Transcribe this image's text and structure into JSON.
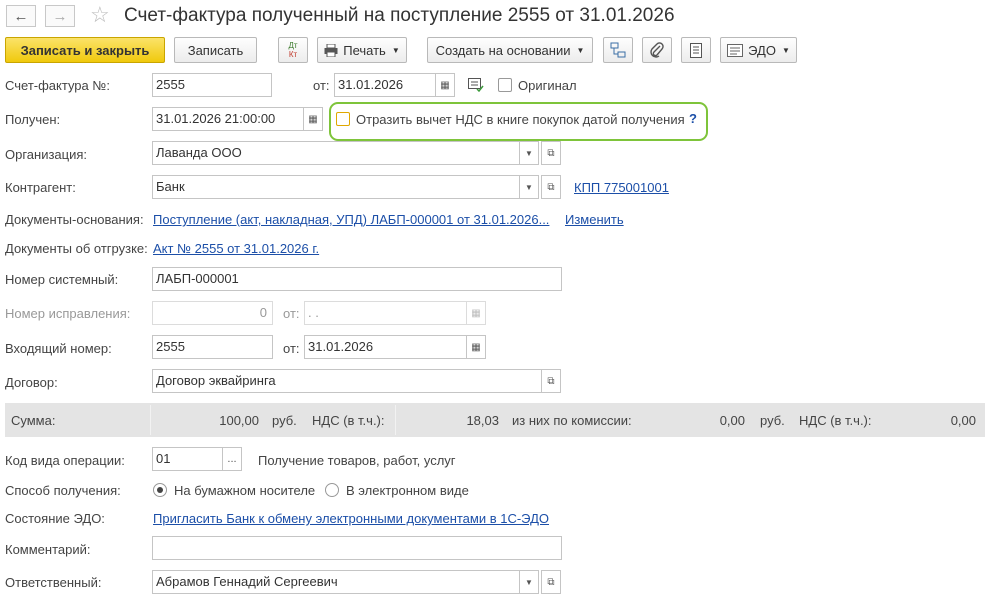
{
  "header": {
    "title": "Счет-фактура полученный на поступление 2555 от 31.01.2026"
  },
  "toolbar": {
    "save_close": "Записать и закрыть",
    "save": "Записать",
    "dtkt_top": "Дт",
    "dtkt_bottom": "Кт",
    "print": "Печать",
    "create_based": "Создать на основании",
    "edo": "ЭДО"
  },
  "form": {
    "invoice_label": "Счет-фактура №:",
    "invoice_number": "2555",
    "from_label": "от:",
    "invoice_date": "31.01.2026",
    "original_label": "Оригинал",
    "received_label": "Получен:",
    "received_datetime": "31.01.2026 21:00:00",
    "vat_deduction_label": "Отразить вычет НДС в книге покупок датой получения",
    "help_mark": "?",
    "organization_label": "Организация:",
    "organization": "Лаванда ООО",
    "counterparty_label": "Контрагент:",
    "counterparty": "Банк",
    "kpp_link": "КПП 775001001",
    "base_docs_label": "Документы-основания:",
    "base_docs_link": "Поступление (акт, накладная, УПД) ЛАБП-000001 от 31.01.2026...",
    "change_link": "Изменить",
    "shipment_docs_label": "Документы об отгрузке:",
    "shipment_docs_link": "Акт № 2555 от 31.01.2026 г.",
    "system_number_label": "Номер системный:",
    "system_number": "ЛАБП-000001",
    "correction_number_label": "Номер исправления:",
    "correction_number": "0",
    "correction_from_label": "от:",
    "correction_date": " .  .",
    "incoming_number_label": "Входящий номер:",
    "incoming_number": "2555",
    "incoming_from_label": "от:",
    "incoming_date": "31.01.2026",
    "contract_label": "Договор:",
    "contract": "Договор эквайринга"
  },
  "summary": {
    "sum_label": "Сумма:",
    "sum_value": "100,00",
    "currency": "руб.",
    "vat_label": "НДС (в т.ч.):",
    "vat_value": "18,03",
    "commission_label": "из них по комиссии:",
    "commission_value": "0,00",
    "commission_currency": "руб.",
    "commission_vat_label": "НДС (в т.ч.):",
    "commission_vat_value": "0,00"
  },
  "details": {
    "operation_code_label": "Код вида операции:",
    "operation_code": "01",
    "operation_code_btn": "...",
    "operation_desc": "Получение товаров, работ, услуг",
    "method_label": "Способ получения:",
    "method_paper": "На бумажном носителе",
    "method_electronic": "В электронном виде",
    "edo_state_label": "Состояние ЭДО:",
    "edo_invite_link": "Пригласить Банк к обмену электронными документами в 1С-ЭДО",
    "comment_label": "Комментарий:",
    "comment": "",
    "responsible_label": "Ответственный:",
    "responsible": "Абрамов Геннадий Сергеевич"
  },
  "colors": {
    "primary_button": "#f0c90c",
    "link": "#1c4fa8",
    "highlight": "#7ec43a",
    "summary_bar": "#e4e4e4"
  }
}
